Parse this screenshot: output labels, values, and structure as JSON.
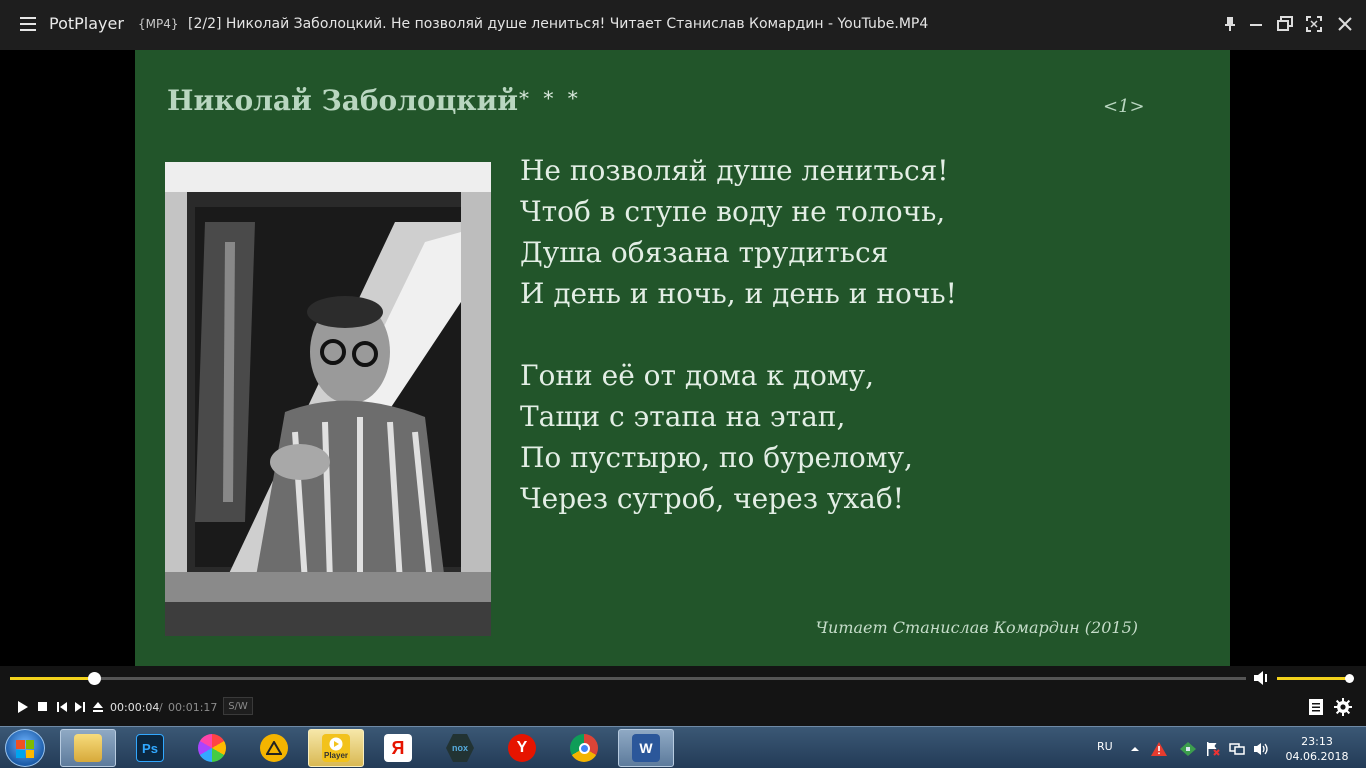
{
  "window": {
    "app_name": "PotPlayer",
    "format": "{MP4}",
    "file_title": "[2/2] Николай Заболоцкий. Не позволяй душе лениться! Читает Станислав Комардин - YouTube.MP4"
  },
  "slide": {
    "author": "Николай Заболоцкий",
    "stars": "* * *",
    "page": "<1>",
    "poem_stanza1": [
      "Не позволяй душе лениться!",
      "Чтоб в ступе воду не толочь,",
      "Душа обязана трудиться",
      "И день и ночь, и день и ночь!"
    ],
    "poem_stanza2": [
      "Гони её от дома к дому,",
      "Тащи с этапа на этап,",
      "По пустырю, по бурелому,",
      "Через сугроб, через ухаб!"
    ],
    "credit": "Читает Станислав Комардин (2015)"
  },
  "playback": {
    "current_time": "00:00:04",
    "separator": "/",
    "total_time": "00:01:17",
    "progress_fraction": 0.068,
    "volume_fraction": 1.0,
    "sw_label": "S/W"
  },
  "taskbar": {
    "language": "RU",
    "time": "23:13",
    "date": "04.06.2018",
    "apps": [
      {
        "name": "explorer-icon",
        "label": ""
      },
      {
        "name": "photoshop-icon",
        "label": "Ps"
      },
      {
        "name": "photos-icon",
        "label": ""
      },
      {
        "name": "aimp-icon",
        "label": ""
      },
      {
        "name": "potplayer-icon",
        "label": "Player"
      },
      {
        "name": "yandex-browser-icon",
        "label": "Я"
      },
      {
        "name": "nox-icon",
        "label": "nox"
      },
      {
        "name": "yandex-icon",
        "label": "Y"
      },
      {
        "name": "chrome-icon",
        "label": ""
      },
      {
        "name": "word-icon",
        "label": "W"
      }
    ]
  },
  "colors": {
    "accent": "#f2d21c",
    "slide_bg": "#22552a",
    "titlebar_bg": "#1e1e1e"
  }
}
